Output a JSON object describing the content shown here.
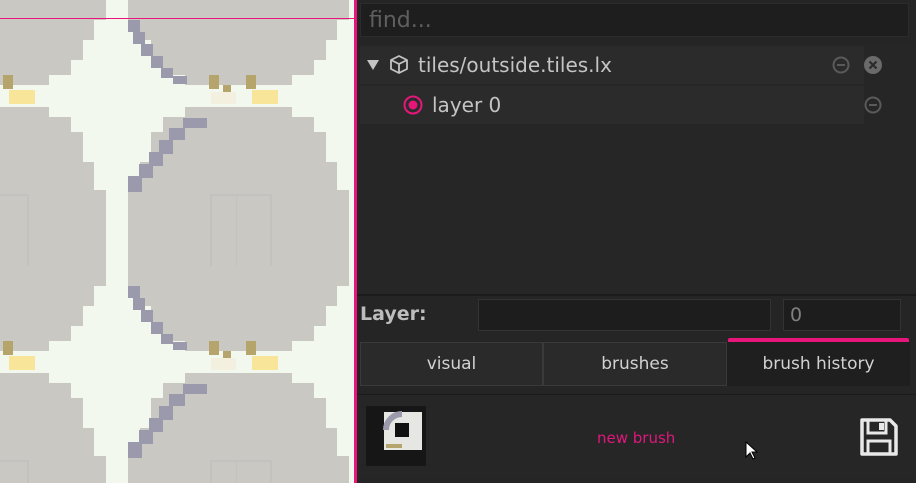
{
  "colors": {
    "accent": "#e8167a",
    "panel_bg": "#252525",
    "tile_gray": "#c9c8c3",
    "tile_white": "#f3f8ef",
    "tile_stone": "#9b9aac",
    "tile_tan": "#b5a56c",
    "tile_yellow": "#f8e59a"
  },
  "search": {
    "placeholder": "find..."
  },
  "tree": {
    "file": {
      "name": "tiles/outside.tiles.lx",
      "toggle_icon": "triangle-down-icon",
      "type_icon": "package-icon",
      "minus_icon": "minus-circle-icon",
      "close_icon": "close-circle-icon"
    },
    "layer": {
      "name": "layer 0",
      "select_icon": "radio-selected-icon",
      "minus_icon": "minus-circle-icon"
    }
  },
  "layer_bar": {
    "label": "Layer:",
    "name_value": "",
    "index_value": "0"
  },
  "tabs": [
    {
      "label": "visual",
      "active": false
    },
    {
      "label": "brushes",
      "active": false
    },
    {
      "label": "brush history",
      "active": true
    }
  ],
  "history": {
    "new_brush_label": "new brush",
    "save_icon": "floppy-disk-icon"
  }
}
